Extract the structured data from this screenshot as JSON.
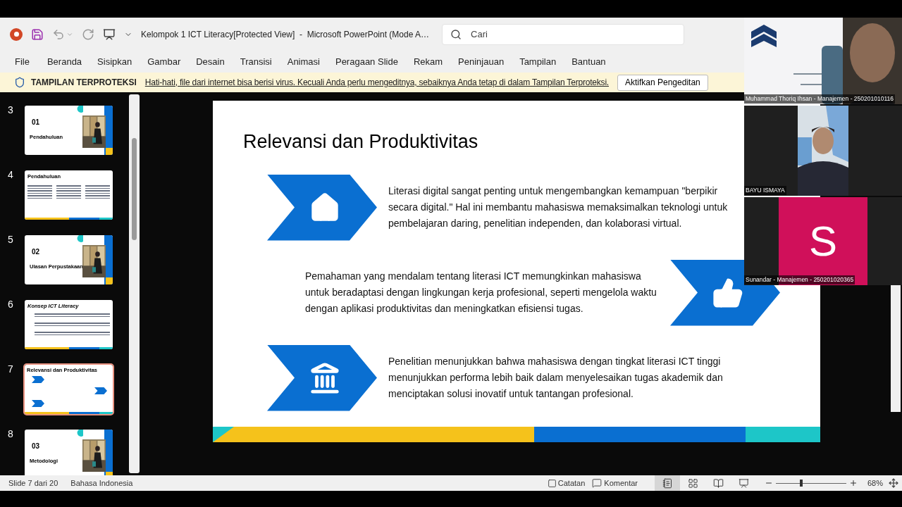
{
  "app_bar": {
    "title": "Kelompok 1 ICT Literacy[Protected View]  -  Microsoft PowerPoint (Mode A…",
    "search": {
      "placeholder": "Cari"
    }
  },
  "menu": [
    "File",
    "Beranda",
    "Sisipkan",
    "Gambar",
    "Desain",
    "Transisi",
    "Animasi",
    "Peragaan Slide",
    "Rekam",
    "Peninjauan",
    "Tampilan",
    "Bantuan"
  ],
  "protected_view": {
    "label": "TAMPILAN TERPROTEKSI",
    "message": "Hati-hati, file dari internet bisa berisi virus. Kecuali Anda perlu mengeditnya, sebaiknya Anda tetap di dalam Tampilan Terproteksi.",
    "button": "Aktifkan Pengeditan"
  },
  "thumbnails": [
    {
      "number": "3",
      "kind": "section",
      "selected": false,
      "heading": "01",
      "title": "Pendahuluan"
    },
    {
      "number": "4",
      "kind": "columns",
      "selected": false,
      "title": "Pendahuluan"
    },
    {
      "number": "5",
      "kind": "section",
      "selected": false,
      "heading": "02",
      "title": "Ulasan Perpustakaan"
    },
    {
      "number": "6",
      "kind": "timeline",
      "selected": false,
      "title": "Konsep ICT Literacy"
    },
    {
      "number": "7",
      "kind": "chevrons",
      "selected": true,
      "title": "Relevansi dan Produktivitas"
    },
    {
      "number": "8",
      "kind": "section",
      "selected": false,
      "heading": "03",
      "title": "Metodologi"
    }
  ],
  "slide": {
    "title": "Relevansi dan Produktivitas",
    "points": [
      {
        "kind": "home",
        "text": "Literasi digital sangat penting untuk mengembangkan kemampuan \"berpikir secara digital.\" Hal ini membantu mahasiswa memaksimalkan teknologi untuk pembelajaran daring, penelitian independen, dan kolaborasi virtual."
      },
      {
        "kind": "thumbs-up",
        "text": "Pemahaman yang mendalam tentang literasi ICT memungkinkan mahasiswa untuk beradaptasi dengan lingkungan kerja profesional, seperti mengelola waktu dengan aplikasi produktivitas dan meningkatkan efisiensi tugas."
      },
      {
        "kind": "bank",
        "text": "Penelitian menunjukkan bahwa mahasiswa dengan tingkat literasi ICT tinggi menunjukkan performa lebih baik dalam menyelesaikan tugas akademik dan menciptakan solusi inovatif untuk tantangan profesional."
      }
    ]
  },
  "participants": [
    {
      "kind": "video",
      "name": "Muhammad Thoriq Ihsan - Manajemen - 250201010116"
    },
    {
      "kind": "video",
      "name": "BAYU ISMAYA"
    },
    {
      "kind": "avatar",
      "initial": "S",
      "color": "#d0105a",
      "name": "Sunandar - Manajemen - 250201020365"
    }
  ],
  "status_bar": {
    "slide": "Slide 7 dari 20",
    "language": "Bahasa Indonesia",
    "notes": "Catatan",
    "comments": "Komentar",
    "views": [
      {
        "kind": "normal",
        "selected": true
      },
      {
        "kind": "sorter",
        "selected": false
      },
      {
        "kind": "reading",
        "selected": false
      },
      {
        "kind": "slideshow",
        "selected": false
      }
    ],
    "zoom": {
      "level": 0.36,
      "reading": "68%"
    }
  }
}
